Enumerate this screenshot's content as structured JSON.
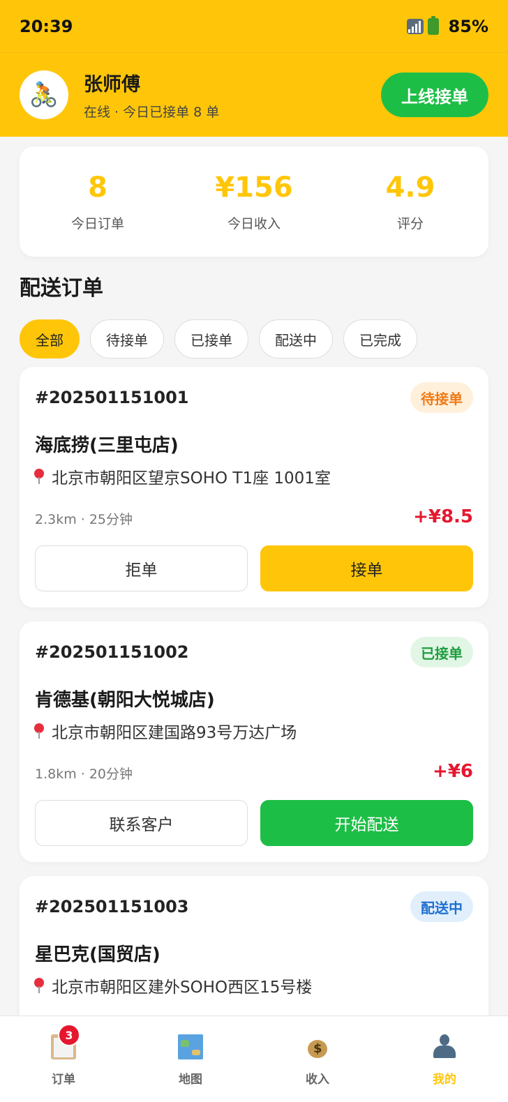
{
  "status_bar": {
    "time": "20:39",
    "battery": "85%"
  },
  "rider": {
    "avatar_emoji": "🚴",
    "name": "张师傅",
    "status": "在线 · 今日已接单 8 单",
    "online_button": "上线接单"
  },
  "stats": [
    {
      "value": "8",
      "label": "今日订单"
    },
    {
      "value": "¥156",
      "label": "今日收入"
    },
    {
      "value": "4.9",
      "label": "评分"
    }
  ],
  "section_title": "配送订单",
  "filters": {
    "active_index": 0,
    "items": [
      "全部",
      "待接单",
      "已接单",
      "配送中",
      "已完成"
    ]
  },
  "orders": [
    {
      "number": "#202501151001",
      "status": "待接单",
      "status_colors": {
        "bg": "#FFF0DC",
        "fg": "#F07A14"
      },
      "shop": "海底捞(三里屯店)",
      "address": "北京市朝阳区望京SOHO T1座 1001室",
      "meta": "2.3km · 25分钟",
      "fee": "+¥8.5",
      "left_button": "拒单",
      "right_button": "接单",
      "right_button_colors": {
        "bg": "#FFC609",
        "fg": "#222222"
      }
    },
    {
      "number": "#202501151002",
      "status": "已接单",
      "status_colors": {
        "bg": "#E2F6E6",
        "fg": "#1E9E3E"
      },
      "shop": "肯德基(朝阳大悦城店)",
      "address": "北京市朝阳区建国路93号万达广场",
      "meta": "1.8km · 20分钟",
      "fee": "+¥6",
      "left_button": "联系客户",
      "right_button": "开始配送",
      "right_button_colors": {
        "bg": "#1DBE46",
        "fg": "#FFFFFF"
      }
    },
    {
      "number": "#202501151003",
      "status": "配送中",
      "status_colors": {
        "bg": "#E1EFFC",
        "fg": "#1E6FD0"
      },
      "shop": "星巴克(国贸店)",
      "address": "北京市朝阳区建外SOHO西区15号楼"
    }
  ],
  "bottom_nav": {
    "active_index": 3,
    "items": [
      {
        "label": "订单",
        "icon": "clipboard-icon",
        "badge": "3"
      },
      {
        "label": "地图",
        "icon": "map-icon"
      },
      {
        "label": "收入",
        "icon": "money-bag-icon"
      },
      {
        "label": "我的",
        "icon": "user-icon"
      }
    ]
  },
  "colors": {
    "brand_yellow": "#FFC609",
    "green": "#1DBE46",
    "price_red": "#E5172F"
  }
}
